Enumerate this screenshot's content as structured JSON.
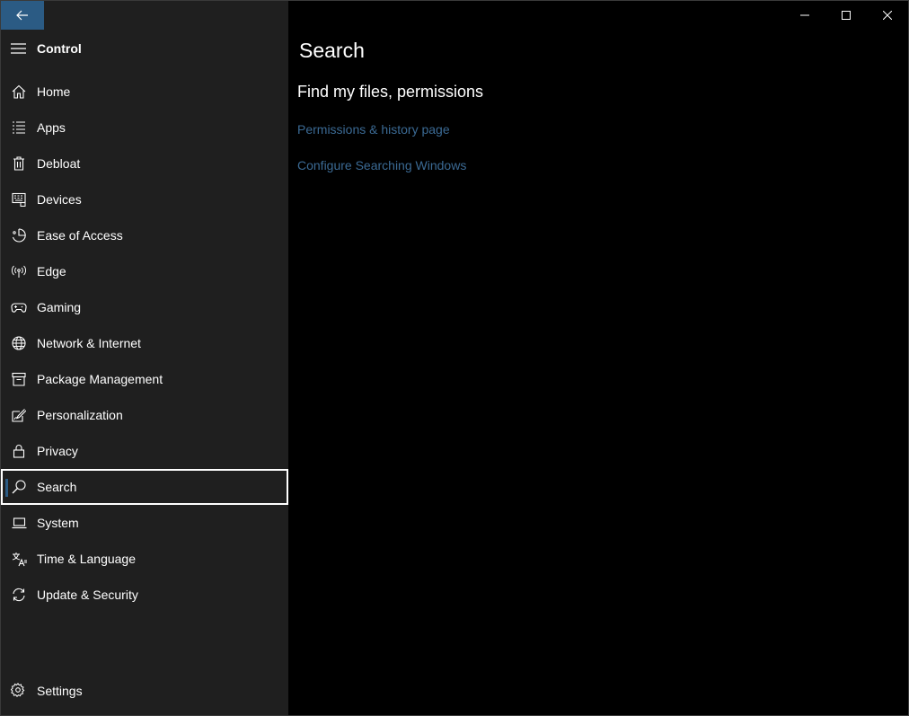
{
  "app": {
    "title": "Control"
  },
  "titlebar": {
    "back_icon": "arrow-left-icon",
    "minimize_icon": "minimize-icon",
    "maximize_icon": "maximize-icon",
    "close_icon": "close-icon"
  },
  "sidebar": {
    "items": [
      {
        "label": "Home",
        "icon": "home-icon"
      },
      {
        "label": "Apps",
        "icon": "apps-list-icon"
      },
      {
        "label": "Debloat",
        "icon": "trash-icon"
      },
      {
        "label": "Devices",
        "icon": "keyboard-icon"
      },
      {
        "label": "Ease of Access",
        "icon": "ease-of-access-icon"
      },
      {
        "label": "Edge",
        "icon": "broadcast-icon"
      },
      {
        "label": "Gaming",
        "icon": "gamepad-icon"
      },
      {
        "label": "Network & Internet",
        "icon": "globe-icon"
      },
      {
        "label": "Package Management",
        "icon": "package-icon"
      },
      {
        "label": "Personalization",
        "icon": "paint-icon"
      },
      {
        "label": "Privacy",
        "icon": "lock-icon"
      },
      {
        "label": "Search",
        "icon": "search-icon",
        "selected": true
      },
      {
        "label": "System",
        "icon": "laptop-icon"
      },
      {
        "label": "Time & Language",
        "icon": "language-icon"
      },
      {
        "label": "Update & Security",
        "icon": "refresh-icon"
      }
    ],
    "settings_label": "Settings"
  },
  "main": {
    "page_title": "Search",
    "section_title": "Find my files, permissions",
    "links": [
      "Permissions & history page",
      "Configure Searching Windows"
    ]
  },
  "colors": {
    "accent": "#2b5b84",
    "link": "#3b6a94",
    "sidebar_bg": "#1f1f1f",
    "content_bg": "#000000"
  }
}
